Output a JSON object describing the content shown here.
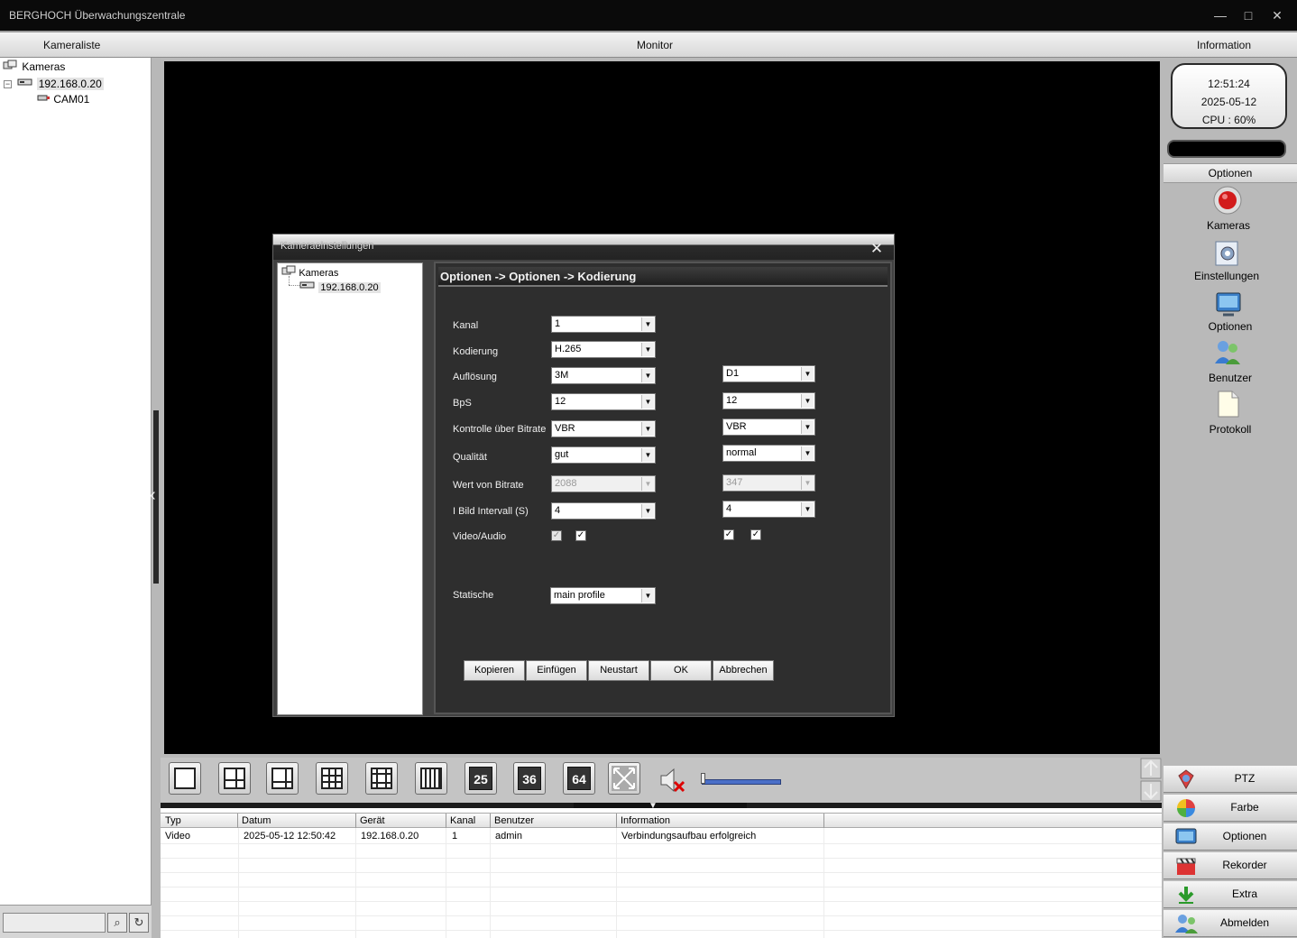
{
  "window": {
    "title": "BERGHOCH Überwachungszentrale",
    "minimize": "—",
    "maximize": "□",
    "close": "✕"
  },
  "header": {
    "left": "Kameraliste",
    "center": "Monitor",
    "right": "Information"
  },
  "camera_tree": {
    "root": "Kameras",
    "device": "192.168.0.20",
    "channel": "CAM01"
  },
  "clock": {
    "time": "12:51:24",
    "date": "2025-05-12",
    "cpu": "CPU : 60%"
  },
  "options_panel": {
    "title": "Optionen",
    "items": [
      {
        "label": "Kameras",
        "icon": "record-icon"
      },
      {
        "label": "Einstellungen",
        "icon": "settings-icon"
      },
      {
        "label": "Optionen",
        "icon": "options-icon"
      },
      {
        "label": "Benutzer",
        "icon": "users-icon"
      },
      {
        "label": "Protokoll",
        "icon": "document-icon"
      }
    ]
  },
  "dialog": {
    "title": "Kameraeinstellungen",
    "close": "✕",
    "tree_root": "Kameras",
    "tree_device": "192.168.0.20",
    "heading": "Optionen -> Optionen -> Kodierung",
    "fields": {
      "kanal": {
        "label": "Kanal",
        "main": "1"
      },
      "kodierung": {
        "label": "Kodierung",
        "main": "H.265"
      },
      "aufloesung": {
        "label": "Auflösung",
        "main": "3M",
        "sub": "D1"
      },
      "bps": {
        "label": "BpS",
        "main": "12",
        "sub": "12"
      },
      "kontrolle": {
        "label": "Kontrolle über Bitrate",
        "main": "VBR",
        "sub": "VBR"
      },
      "qualitaet": {
        "label": "Qualität",
        "main": "gut",
        "sub": "normal"
      },
      "bitrate": {
        "label": "Wert von Bitrate",
        "main": "2088",
        "sub": "347"
      },
      "intervall": {
        "label": "I Bild Intervall (S)",
        "main": "4",
        "sub": "4"
      },
      "videoaudio": {
        "label": "Video/Audio"
      },
      "statische": {
        "label": "Statische",
        "main": "main profile"
      }
    },
    "buttons": {
      "kopieren": "Kopieren",
      "einfuegen": "Einfügen",
      "neustart": "Neustart",
      "ok": "OK",
      "abbrechen": "Abbrechen"
    }
  },
  "toolbar": {
    "n25": "25",
    "n36": "36",
    "n64": "64"
  },
  "log": {
    "columns": [
      "Typ",
      "Datum",
      "Gerät",
      "Kanal",
      "Benutzer",
      "Information"
    ],
    "rows": [
      [
        "Video",
        "2025-05-12 12:50:42",
        "192.168.0.20",
        "1",
        "admin",
        "Verbindungsaufbau erfolgreich"
      ]
    ]
  },
  "bottom_menu": [
    "PTZ",
    "Farbe",
    "Optionen",
    "Rekorder",
    "Extra",
    "Abmelden"
  ],
  "search": {
    "value": ""
  }
}
